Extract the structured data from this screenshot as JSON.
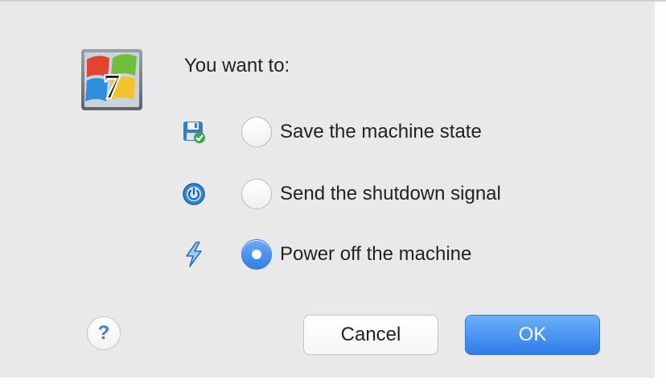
{
  "dialog": {
    "app_icon": "windows7-vm-icon",
    "prompt": "You want to:",
    "options": [
      {
        "icon": "save-state-icon",
        "label": "Save the machine state",
        "checked": false
      },
      {
        "icon": "power-button-icon",
        "label": "Send the shutdown signal",
        "checked": false
      },
      {
        "icon": "lightning-bolt-icon",
        "label": "Power off the machine",
        "checked": true
      }
    ],
    "help_label": "?",
    "cancel_label": "Cancel",
    "ok_label": "OK"
  },
  "colors": {
    "accent": "#2f7fea",
    "background": "#e9e9e9",
    "text": "#222222"
  }
}
